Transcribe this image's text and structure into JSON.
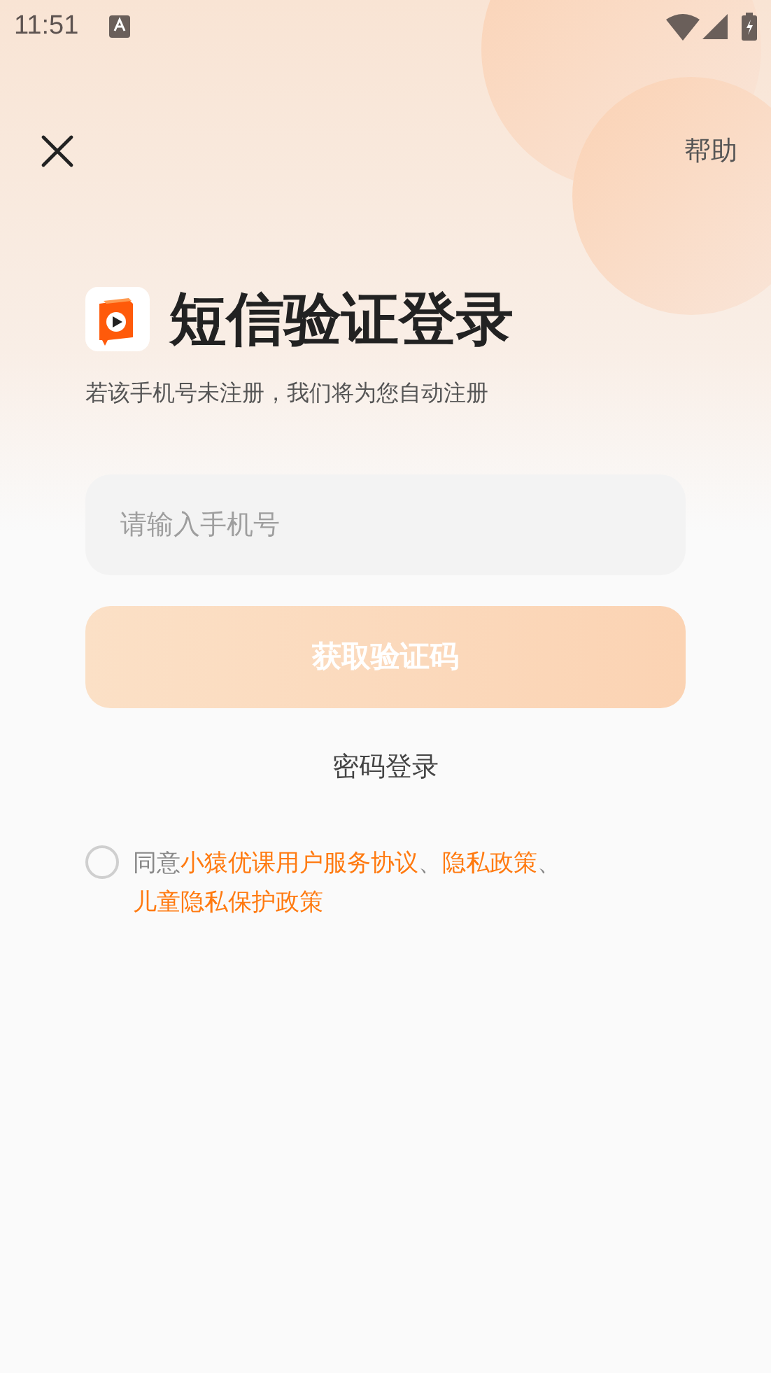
{
  "status_bar": {
    "time": "11:51"
  },
  "nav": {
    "help": "帮助"
  },
  "title": "短信验证登录",
  "subtitle": "若该手机号未注册，我们将为您自动注册",
  "phone_field": {
    "placeholder": "请输入手机号"
  },
  "get_code_button": {
    "label": "获取验证码",
    "disabled": true
  },
  "password_login": "密码登录",
  "agreement": {
    "checked": false,
    "prefix": "同意",
    "parts": [
      {
        "kind": "link",
        "text": "小猿优课用户服务协议"
      },
      {
        "kind": "text",
        "text": "、"
      },
      {
        "kind": "link",
        "text": "隐私政策"
      },
      {
        "kind": "text",
        "text": "、"
      },
      {
        "kind": "link",
        "text": "儿童隐私保护政策"
      }
    ]
  }
}
